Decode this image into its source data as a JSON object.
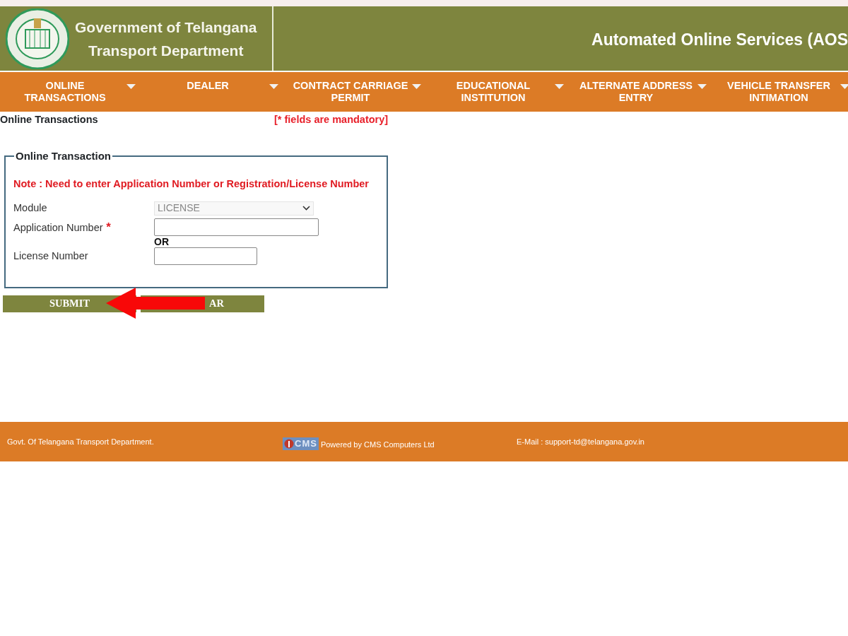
{
  "header": {
    "title_lines": [
      "Government of Telangana",
      "Transport Department"
    ],
    "banner": "Automated Online Services (AOS"
  },
  "menu": [
    {
      "label": "ONLINE TRANSACTIONS",
      "selected": false
    },
    {
      "label": "DEALER",
      "selected": false
    },
    {
      "label": "CONTRACT CARRIAGE PERMIT",
      "selected": false
    },
    {
      "label": "EDUCATIONAL INSTITUTION",
      "selected": false
    },
    {
      "label": "ALTERNATE ADDRESS ENTRY",
      "selected": false
    },
    {
      "label": "VEHICLE TRANSFER INTIMATION",
      "selected": false
    }
  ],
  "page_title": "Online  Transactions",
  "mandatory_note": "[* fields are mandatory]",
  "form": {
    "legend": "Online Transaction",
    "note": "Note : Need to enter Application Number or Registration/License Number",
    "fields": [
      {
        "kind": "select",
        "label": "Module",
        "value": "LICENSE",
        "disabled": true
      },
      {
        "kind": "text",
        "label": "Application Number",
        "required": true,
        "mark": "*"
      },
      {
        "kind": "separator",
        "label": "OR"
      },
      {
        "kind": "text",
        "label": "License Number"
      }
    ]
  },
  "buttons": [
    {
      "label": "SUBMIT"
    },
    {
      "label": "AR"
    }
  ],
  "footer": {
    "left": "Govt. Of Telangana Transport Department.",
    "logo_text": "CMS",
    "powered": "Powered by CMS Computers Ltd",
    "email": "E-Mail : support-td@telangana.gov.in"
  }
}
